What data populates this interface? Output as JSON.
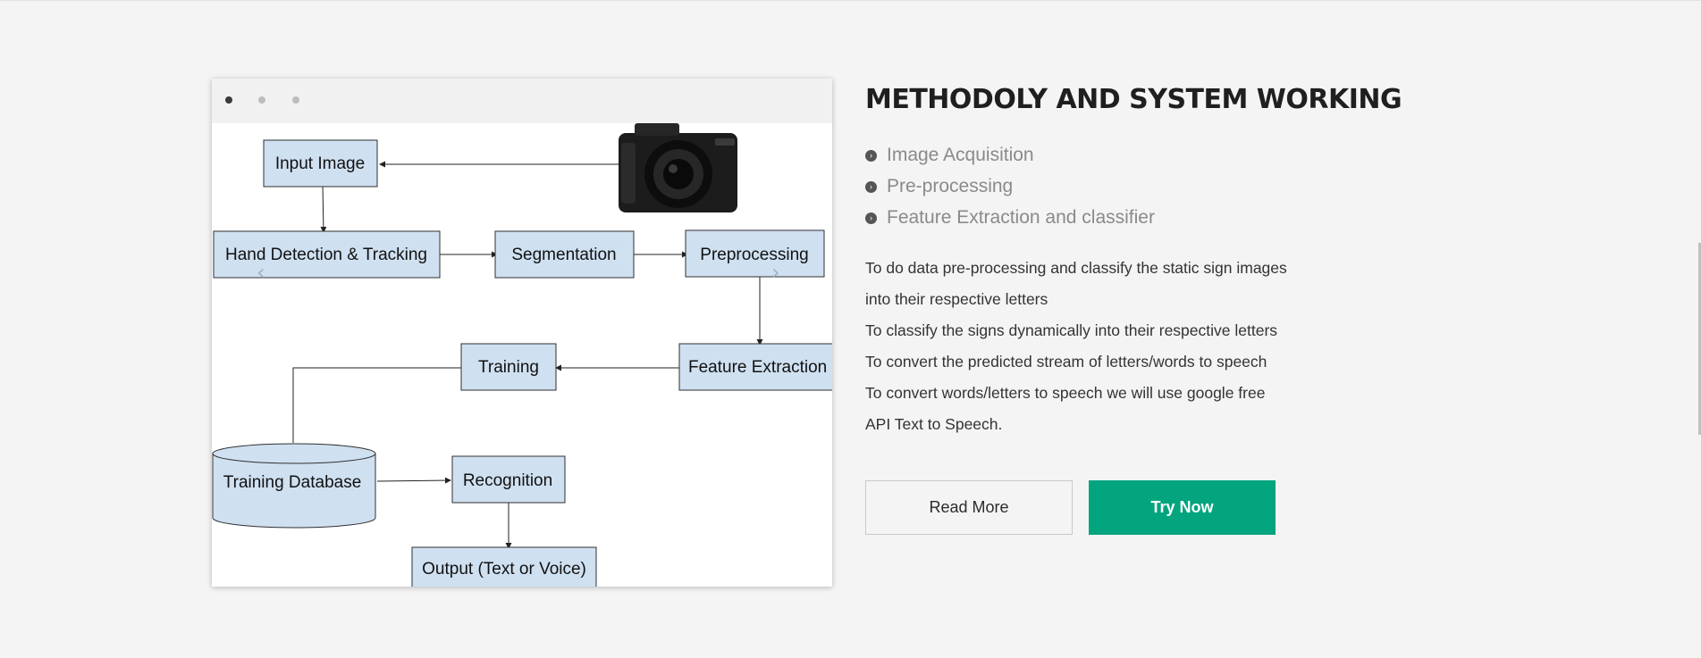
{
  "slider": {
    "active_index": 0,
    "total_slides": 3,
    "prev_arrow": "‹",
    "next_arrow": "›",
    "diagram": {
      "nodes": {
        "input_image": "Input Image",
        "hand_detection": "Hand Detection & Tracking",
        "segmentation": "Segmentation",
        "preprocessing": "Preprocessing",
        "feature_extraction": "Feature Extraction",
        "training": "Training",
        "training_database": "Training Database",
        "recognition": "Recognition",
        "output": "Output (Text or Voice)"
      },
      "colors": {
        "node_fill": "#cfe0f1",
        "node_stroke": "#2f2f2f"
      }
    }
  },
  "section": {
    "title": "METHODOLY AND SYSTEM WORKING",
    "features": [
      "Image Acquisition",
      "Pre-processing",
      "Feature Extraction and classifier"
    ],
    "bullet_icon": "circle-chevron-right-icon",
    "description_lines": [
      "To do data pre-processing and classify the static sign images",
      "into their respective letters",
      "To classify the signs dynamically into their respective letters",
      "To convert the predicted stream of letters/words to speech",
      "To convert words/letters to speech we will use google free",
      "API Text to Speech."
    ]
  },
  "buttons": {
    "read_more": "Read More",
    "try_now": "Try Now"
  },
  "colors": {
    "page_bg": "#f4f4f4",
    "accent": "#03a57e",
    "title": "#1f1f1f",
    "feature_text": "#8a8a8a"
  }
}
